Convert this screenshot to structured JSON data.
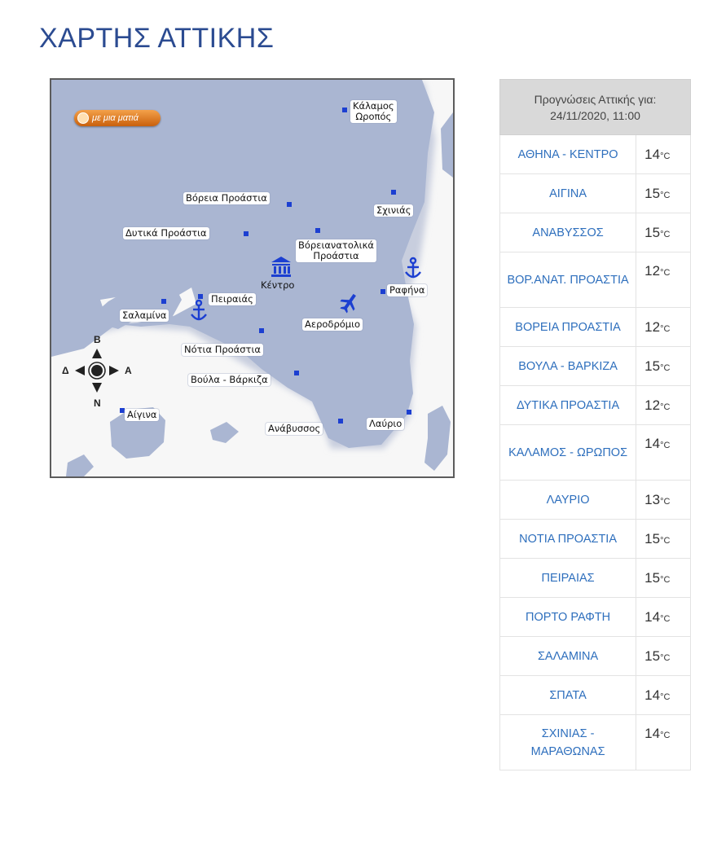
{
  "page": {
    "title": "ΧΑΡΤΗΣ ΑΤΤΙΚΗΣ"
  },
  "map": {
    "one_click_label": "με μια ματιά",
    "labels": {
      "kalamos": "Κάλαμος\nΩροπός",
      "voreia": "Βόρεια Προάστια",
      "schinias": "Σχινιάς",
      "dytika": "Δυτικά Προάστια",
      "voreioanatolika": "Βόρειανατολικά\nΠροάστια",
      "kentro": "Κέντρο",
      "rafina": "Ραφήνα",
      "peiraias": "Πειραιάς",
      "salamina": "Σαλαμίνα",
      "aerodromio": "Αεροδρόμιο",
      "notia": "Νότια Προάστια",
      "voula": "Βούλα - Βάρκιζα",
      "aigina": "Αίγινα",
      "anavyssos": "Ανάβυσσος",
      "lavrio": "Λαύριο"
    },
    "compass": {
      "north": "Β",
      "south": "Ν",
      "west": "Δ",
      "east": "Α"
    },
    "colors": {
      "land": "#aab6d2",
      "sea": "#f7f7f7",
      "marker": "#1c3fd1",
      "button": "#e07a1f"
    }
  },
  "forecast": {
    "header": "Προγνώσεις Αττικής για: 24/11/2020, 11:00",
    "unit": "°C",
    "rows": [
      {
        "place": "ΑΘΗΝΑ - ΚΕΝΤΡΟ",
        "temp": "14"
      },
      {
        "place": "ΑΙΓΙΝΑ",
        "temp": "15"
      },
      {
        "place": "ΑΝΑΒΥΣΣΟΣ",
        "temp": "15"
      },
      {
        "place": "ΒΟΡ.ΑΝΑΤ. ΠΡΟΑΣΤΙΑ",
        "temp": "12"
      },
      {
        "place": "ΒΟΡΕΙΑ ΠΡΟΑΣΤΙΑ",
        "temp": "12"
      },
      {
        "place": "ΒΟΥΛΑ - ΒΑΡΚΙΖΑ",
        "temp": "15"
      },
      {
        "place": "ΔΥΤΙΚΑ ΠΡΟΑΣΤΙΑ",
        "temp": "12"
      },
      {
        "place": "ΚΑΛΑΜΟΣ - ΩΡΩΠΟΣ",
        "temp": "14"
      },
      {
        "place": "ΛΑΥΡΙΟ",
        "temp": "13"
      },
      {
        "place": "ΝΟΤΙΑ ΠΡΟΑΣΤΙΑ",
        "temp": "15"
      },
      {
        "place": "ΠΕΙΡΑΙΑΣ",
        "temp": "15"
      },
      {
        "place": "ΠΟΡΤΟ ΡΑΦΤΗ",
        "temp": "14"
      },
      {
        "place": "ΣΑΛΑΜΙΝΑ",
        "temp": "15"
      },
      {
        "place": "ΣΠΑΤΑ",
        "temp": "14"
      },
      {
        "place": "ΣΧΙΝΙΑΣ - ΜΑΡΑΘΩΝΑΣ",
        "temp": "14"
      }
    ]
  }
}
